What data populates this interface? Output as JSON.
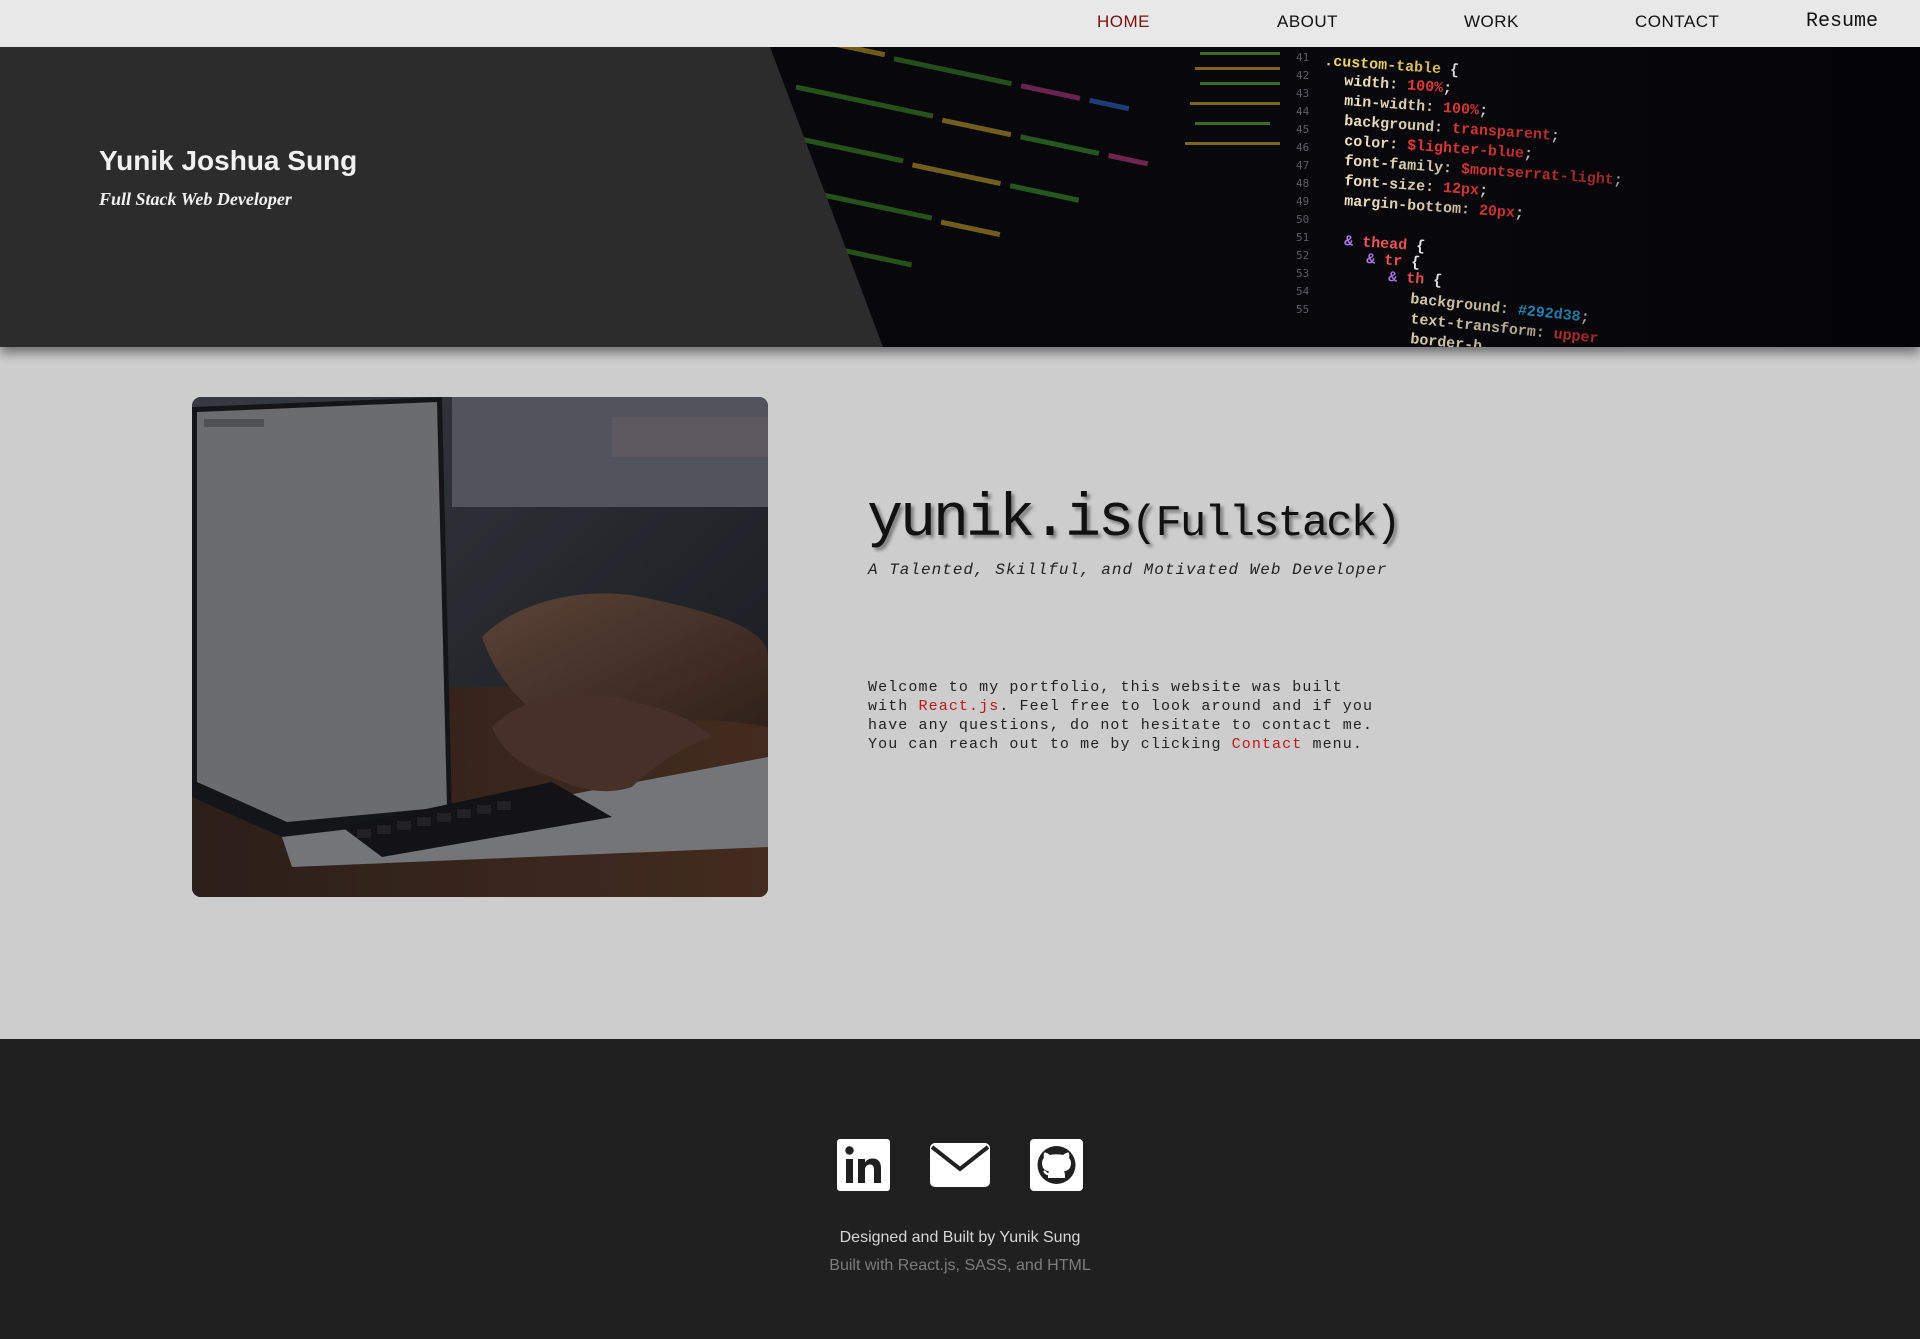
{
  "nav": {
    "items": [
      {
        "label": "HOME"
      },
      {
        "label": "ABOUT"
      },
      {
        "label": "WORK"
      },
      {
        "label": "CONTACT"
      },
      {
        "label": "Resume"
      }
    ]
  },
  "hero": {
    "name": "Yunik Joshua Sung",
    "role": "Full Stack Web Developer",
    "code_lines": [
      {
        "num": "41",
        "text": ".custom-table {"
      },
      {
        "num": "42",
        "prop": "width:",
        "val": "100%;"
      },
      {
        "num": "43",
        "prop": "min-width:",
        "val": "100%;"
      },
      {
        "num": "44",
        "prop": "background:",
        "val": "transparent;"
      },
      {
        "num": "45",
        "prop": "color:",
        "val": "$lighter-blue;"
      },
      {
        "num": "46",
        "prop": "font-family:",
        "val": "$montserrat-light;"
      },
      {
        "num": "47",
        "prop": "font-size:",
        "val": "12px;"
      },
      {
        "num": "48",
        "prop": "margin-bottom:",
        "val": "20px;"
      },
      {
        "num": "49",
        "text": ""
      },
      {
        "num": "50",
        "text": "& thead {"
      },
      {
        "num": "51",
        "text": "& tr {"
      },
      {
        "num": "52",
        "text": "& th {"
      },
      {
        "num": "53",
        "prop": "background:",
        "val": "#292d38;"
      },
      {
        "num": "54",
        "prop": "text-transform:",
        "val": "upper"
      },
      {
        "num": "55",
        "prop": "border-b",
        "val": ""
      }
    ]
  },
  "intro": {
    "title_main": "yunik.is",
    "title_paren": "(Fullstack)",
    "subtitle": "A Talented, Skillful, and Motivated Web Developer",
    "body_1": "Welcome to my portfolio, this website was built\nwith ",
    "body_link_1": "React.js",
    "body_2": ". Feel free to look around and if you\nhave any questions, do not hesitate to contact me.\nYou can reach out to me by clicking ",
    "body_link_2": "Contact",
    "body_3": " menu."
  },
  "footer": {
    "social": [
      {
        "icon": "linkedin-icon"
      },
      {
        "icon": "mail-icon"
      },
      {
        "icon": "github-icon"
      }
    ],
    "credit": "Designed and Built by Yunik Sung",
    "tech": "Built with React.js, SASS, and HTML"
  },
  "colors": {
    "nav_bg": "#e8e8e8",
    "nav_active": "#7a0f0f",
    "hero_panel": "#2c2c2c",
    "page_bg": "#cdcdcd",
    "link_red": "#c0141a",
    "footer_bg": "#202020"
  }
}
